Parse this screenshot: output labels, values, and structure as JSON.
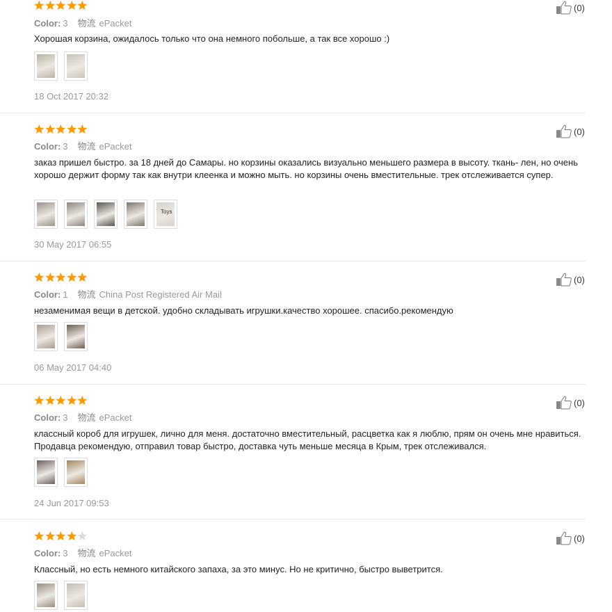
{
  "labels": {
    "color": "Color:",
    "shipping": "物流"
  },
  "colors": {
    "star": "#f90",
    "star_empty": "#ddd",
    "meta": "#999",
    "divider": "#e8e8e8"
  },
  "icons": {
    "rating": "star-icon",
    "like": "thumbs-up-icon"
  },
  "reviews": [
    {
      "rating": 5,
      "color": "3",
      "shipping": "ePacket",
      "text": "Хорошая корзина, ожидалось только что она немного побольше, а так все хорошо :)",
      "photos": [
        "#b9b2a4",
        "#c9c2b8"
      ],
      "date": "18 Oct 2017 20:32",
      "likes": "(0)"
    },
    {
      "rating": 5,
      "color": "3",
      "shipping": "ePacket",
      "text": "заказ пришел быстро. за 18 дней до Самары. но корзины оказались визуально меньшего размера в высоту. ткань- лен, но очень хорошо держит форму так как внутри клеенка и можно мыть. но корзины очень вместительные. трек отслеживается супер.",
      "photos": [
        "#9a938a",
        "#8c8780",
        "#5a5650",
        "#7d776f",
        "#d8d3cc"
      ],
      "photo_caption": "Toys",
      "date": "30 May 2017 06:55",
      "likes": "(0)"
    },
    {
      "rating": 5,
      "color": "1",
      "shipping": "China Post Registered Air Mail",
      "text": "незаменимая вещи в детской. удобно складывать игрушки.качество хорошее. спасибо.рекомендую",
      "photos": [
        "#a79e8f",
        "#6e5f52"
      ],
      "date": "06 May 2017 04:40",
      "likes": "(0)"
    },
    {
      "rating": 5,
      "color": "3",
      "shipping": "ePacket",
      "text": "классный короб для игрушек, лично для меня. достаточно вместительный, расцветка как я люблю, прям он очень мне нравиться. Продавца рекомендую, отправил товар быстро, доставка чуть меньше месяца в Крым, трек отслеживался.",
      "photos": [
        "#6d5f60",
        "#a3865f"
      ],
      "date": "24 Jun 2017 09:53",
      "likes": "(0)"
    },
    {
      "rating": 4,
      "color": "3",
      "shipping": "ePacket",
      "text": "Классный, но есть немного китайского запаха, за это минус. Но не критично, быстро выветрится.",
      "photos": [
        "#9b8f80",
        "#c5bdb2"
      ],
      "date": "",
      "likes": "(0)"
    }
  ]
}
